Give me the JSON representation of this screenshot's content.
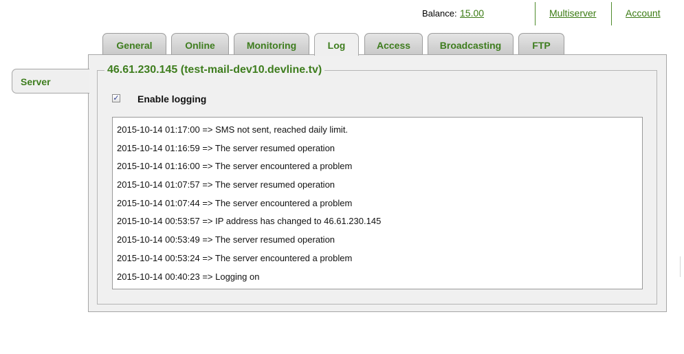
{
  "header": {
    "balance_label": "Balance:",
    "balance_value": "15.00",
    "links": [
      "Multiserver",
      "Account"
    ]
  },
  "tabs": [
    {
      "label": "General",
      "active": false
    },
    {
      "label": "Online",
      "active": false
    },
    {
      "label": "Monitoring",
      "active": false
    },
    {
      "label": "Log",
      "active": true
    },
    {
      "label": "Access",
      "active": false
    },
    {
      "label": "Broadcasting",
      "active": false
    },
    {
      "label": "FTP",
      "active": false
    }
  ],
  "sidebar": {
    "items": [
      {
        "label": "Server",
        "active": true
      }
    ]
  },
  "server": {
    "title": "46.61.230.145 (test-mail-dev10.devline.tv)"
  },
  "logging": {
    "checkbox_label": "Enable logging",
    "checked": true,
    "entries": [
      "2015-10-14 01:17:00 => SMS not sent, reached daily limit.",
      "2015-10-14 01:16:59 => The server resumed operation",
      "2015-10-14 01:16:00 => The server encountered a problem",
      "2015-10-14 01:07:57 => The server resumed operation",
      "2015-10-14 01:07:44 => The server encountered a problem",
      "2015-10-14 00:53:57 => IP address has changed to 46.61.230.145",
      "2015-10-14 00:53:49 => The server resumed operation",
      "2015-10-14 00:53:24 => The server encountered a problem",
      "2015-10-14 00:40:23 => Logging on"
    ]
  },
  "colors": {
    "accent_green": "#3e7d1e",
    "link_green": "#3a7a12",
    "checkbox_mark": "#2d3c8c"
  }
}
